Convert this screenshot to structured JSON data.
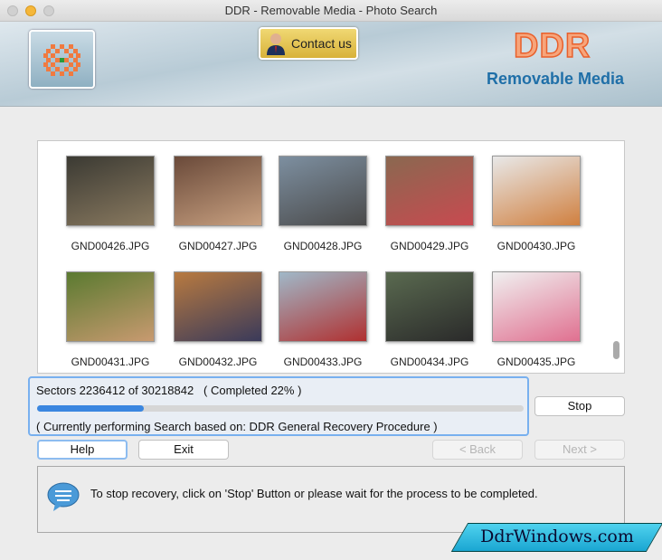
{
  "window": {
    "title": "DDR - Removable Media - Photo Search"
  },
  "header": {
    "contact_label": "Contact us",
    "brand": "DDR",
    "product": "Removable Media"
  },
  "gallery": {
    "items": [
      {
        "name": "GND00426.JPG",
        "colors": [
          "#3b3a33",
          "#8a7a60"
        ]
      },
      {
        "name": "GND00427.JPG",
        "colors": [
          "#6a4a3a",
          "#c8a080"
        ]
      },
      {
        "name": "GND00428.JPG",
        "colors": [
          "#7d8fa0",
          "#4a4a4a"
        ]
      },
      {
        "name": "GND00429.JPG",
        "colors": [
          "#8a6850",
          "#c84a50"
        ]
      },
      {
        "name": "GND00430.JPG",
        "colors": [
          "#e8e8e8",
          "#d08040"
        ]
      },
      {
        "name": "GND00431.JPG",
        "colors": [
          "#5a7a30",
          "#c89a70"
        ]
      },
      {
        "name": "GND00432.JPG",
        "colors": [
          "#b87a40",
          "#3a3a5a"
        ]
      },
      {
        "name": "GND00433.JPG",
        "colors": [
          "#a0b8c8",
          "#b03030"
        ]
      },
      {
        "name": "GND00434.JPG",
        "colors": [
          "#5a6a50",
          "#2a2a2a"
        ]
      },
      {
        "name": "GND00435.JPG",
        "colors": [
          "#f0f0f0",
          "#e07090"
        ]
      }
    ]
  },
  "progress": {
    "sectors_text": "Sectors 2236412 of 30218842   ( Completed 22% )",
    "percent": 22,
    "status_text": "( Currently performing Search based on: DDR General Recovery Procedure )",
    "color": "#3a86e0"
  },
  "buttons": {
    "stop": "Stop",
    "help": "Help",
    "exit": "Exit",
    "back": "< Back",
    "next": "Next >"
  },
  "message": {
    "text": "To stop recovery, click on 'Stop' Button or please wait for the process to be completed.",
    "icon": "speech-bubble-icon"
  },
  "watermark": "DdrWindows.com"
}
